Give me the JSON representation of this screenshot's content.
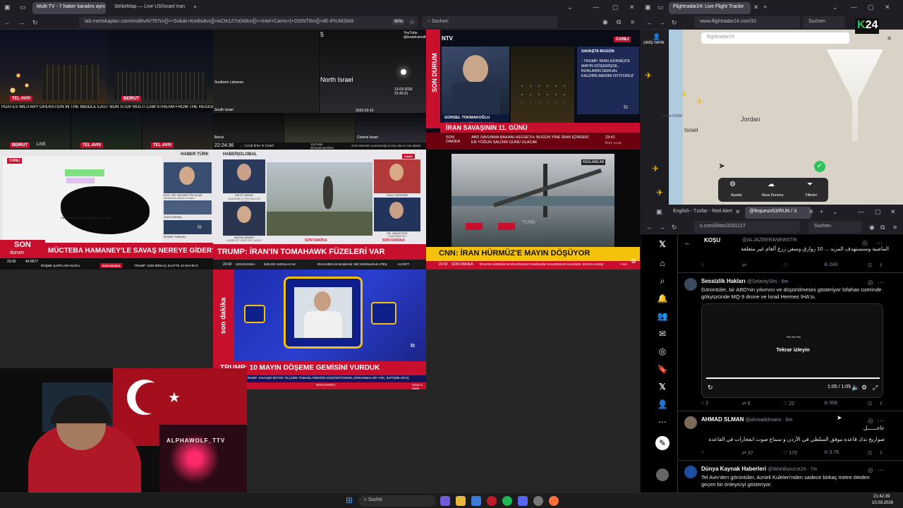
{
  "browser_left": {
    "tabs": [
      {
        "label": "Multi TV - 7 haber kanalını aynı",
        "active": true
      },
      {
        "label": "StrikeMap — Live US/Israel Iran",
        "active": false
      }
    ],
    "url": "lab.mertskaplan.com/multitv/tr/?9?cn[]=+Sokak+Kedisi8vs[]=ioCle127o0A8cn[]=+Intel+Cams+|+OSINT8vs[]=4E-iFtUM2kk8",
    "zoom": "90%",
    "search_placeholder": "Suchen"
  },
  "tiles": {
    "t1": {
      "labels": [
        "TEL AVIV",
        "BEIRUT",
        "BEIRUT",
        "TEL AVIV",
        "TEL AVIV"
      ],
      "ticker": "PDATES MILITARY OPERATION IN THE MIDDLE EAST NON STOP MULTI CAM STREAM FROM THE REGION US ISRAEL",
      "live": "LIVE"
    },
    "t2": {
      "channel": "YouTube @israelcamslive",
      "num": "5",
      "place": "North Israel",
      "place2": "Southern Lebanon",
      "place3": "South Israel",
      "place4": "Central Israel",
      "place5": "Beirut",
      "ts1": "13-03-2026 22:42:21",
      "ts2": "2026-03-10",
      "clock": "22:24:36",
      "local": "← Local time in Israel",
      "footer_right": "YouTube @israelcamslive",
      "footer_far": "41% Internet connectivity in Iran due to US attack"
    },
    "t3": {
      "channel": "NTV",
      "live": "CANLI",
      "side": "SON DURUM",
      "panel_title": "SAVAŞTA BUGÜN",
      "panel_text": "- TRUMP: İRAN HÜRMÜZ'E MAYIN DÖŞEMİŞSE, BUNLARIN DERHAL KALDIRILMASINI İSTİYORUZ",
      "guest": "GÜRSEL TOKMAKOĞLU",
      "guest_role": "Hava Kuv. Eski İstihbarat Daire Bşk.",
      "headline": "İRAN SAVAŞININ 11. GÜNÜ",
      "sub_label": "SON DAKİKA",
      "sub_text": "ABD SAVUNMA BAKANI HEGSETH: BUGÜN YİNE İRAN İÇİNDEKİ EN YOĞUN SALDIRI GÜNÜ OLACAK",
      "time": "23:42",
      "time2": "İRST 13:15"
    },
    "t4": {
      "channel": "HABER TÜRK",
      "guest1": "DOÇ. DR. NECMETTİN ACAR",
      "guest1_role": "Uluslararası İlişkiler Uzmanı",
      "guest2": "TALİH KIRKAL",
      "guest3": "İSTEMİ TÜRKAN",
      "caption": "ABD-İSRAİL İRAN SAVAŞININ 11. GÜN",
      "live": "CANLI",
      "side_top": "SON",
      "side_bottom": "durum",
      "headline": "MÜCTEBA HAMANEY'LE SAVAŞ NEREYE GİDER?",
      "time": "23:42",
      "value": "44.8677",
      "ticker_a": "RÜŞME ŞARTLARA BAĞLI",
      "ticker_label": "SON DAKİKA",
      "ticker_b": "TRUMP: SON BİRKAÇ SAATTE 10 MAYIN D"
    },
    "t5": {
      "channel": "HABER|GLOBAL",
      "live": "CANLI",
      "g1": "METE TARAR",
      "g1_role": "AKADEMİK & POLİTİKA LAR UZMANI",
      "g2": "NEDİM ŞENER",
      "g2_role": "HÜRRİYET GAZETESİ YAZARI",
      "g3": "HİLAL ÖZDEMİR",
      "g4": "DR. ONUR İSTE",
      "g4_role": "AKADEMİSYEN",
      "lbl1": "SON DAKİKA",
      "lbl2": "SON DAKİKA",
      "headline": "TRUMP: İRAN'IN TOMAHAWK FÜZELERİ VAR",
      "time": "23:42",
      "ticker_label": "SON DAKİKA",
      "ticker_a": "EKİLDE VURULACAK",
      "ticker_b": "İRAN MECLİS BAŞKANI: BİZ KESİNLİKLE ATEŞ",
      "value": "44.0077"
    },
    "t6": {
      "badge": "REKLAMLAR",
      "headline": "CNN: İRAN HÜRMÜZ'E MAYIN DÖŞÜYOR",
      "time": "23:42",
      "ticker_label": "SON DAKİKA",
      "ticker_text": "İRAN'IN HÜRMÜZ BOĞAZI'NDAKİ GEMİLERE SALDIRMASI HALİNDE, İRAN'A KARŞI",
      "value": "7.341",
      "watermark": "TÜRK"
    },
    "t7": {
      "side": "son dakika",
      "headline": "TRUMP: 10 MAYIN DÖŞEME GEMİSİNİ VURDUK",
      "ticker": "TRUMP: SAVAŞIN BÜYÜK ÖLÇÜDE TAMAMLANDIĞINI DÜŞÜNÜYORUM, DONANMALARI YOK, İLETİŞİM ARAÇ",
      "ticker_label": "SON DAKİKA",
      "value": "DEDE A ANİM"
    }
  },
  "webcam": {
    "tag": "ALPHAWOLF_TTV"
  },
  "browser_fr24": {
    "tab": "Flightradar24: Live Flight Tracke",
    "url": "www.flightradar24.com/31",
    "search_placeholder": "Suchen",
    "login": "GİRİŞ YAPIN",
    "search_box": "flightradar24",
    "map_labels": [
      "Jordan",
      "Israel",
      "GAZA STRIP"
    ],
    "tools": [
      "Ayarlar",
      "Hava Durumu",
      "Filtreler"
    ],
    "logo": "24"
  },
  "browser_x": {
    "tabs": [
      {
        "label": "English - Tzofar - Red Alert",
        "active": false
      },
      {
        "label": "@fequeun53/RUN / X",
        "active": true
      }
    ],
    "url": "x.com/i/lists/2031127",
    "search_placeholder": "Suchen"
  },
  "tweets": [
    {
      "name": "KOŞU",
      "handle": "@ALJAZEERANEWSTR",
      "text": "الماضية وسنستهدف المزيد ... 10 زوارق وسفن زرع ألغام غير متعلقة",
      "replies": "",
      "retweets": "",
      "likes": "",
      "views": "243"
    },
    {
      "name": "Sessizlik Hakları",
      "handle": "@SelantySlrs · 6m",
      "text": "Görüntüler, bir ABD'nin yıkımını ve düşürülmesini gösteriyor İsfahan üzerinde gökyüzünde MQ-9 drone ve İsrail Hermes İHA'sı.",
      "video_replay": "Tekrar izleyin",
      "video_time": "1:05 / 1:05",
      "replies": "2",
      "retweets": "6",
      "likes": "22",
      "views": "556"
    },
    {
      "name": "AHMAD SLMAN",
      "handle": "@ahmadslmanx · 6m",
      "text": "صواريخ تدك قاعدة موفق السلطي في الأردن و سماع صوت انفجارات في القاعدة",
      "text_top": "عاجــــــل",
      "replies": "",
      "retweets": "37",
      "likes": "170",
      "views": "3.7K"
    },
    {
      "name": "Dünya Kaynak Haberleri",
      "handle": "@Worldsource24 · 7m",
      "text": "Tel Aviv'den görüntüler, Azrieli Kuleleri'nden sadece birkaç metre öteden geçen bir önleyiciyi gösteriyor."
    }
  ],
  "taskbar": {
    "search": "Suche",
    "time": "21:42:39",
    "date": "10.03.2026"
  },
  "colors": {
    "red": "#c8102e",
    "x_bg": "#000000",
    "map": "#d9d3c7"
  }
}
